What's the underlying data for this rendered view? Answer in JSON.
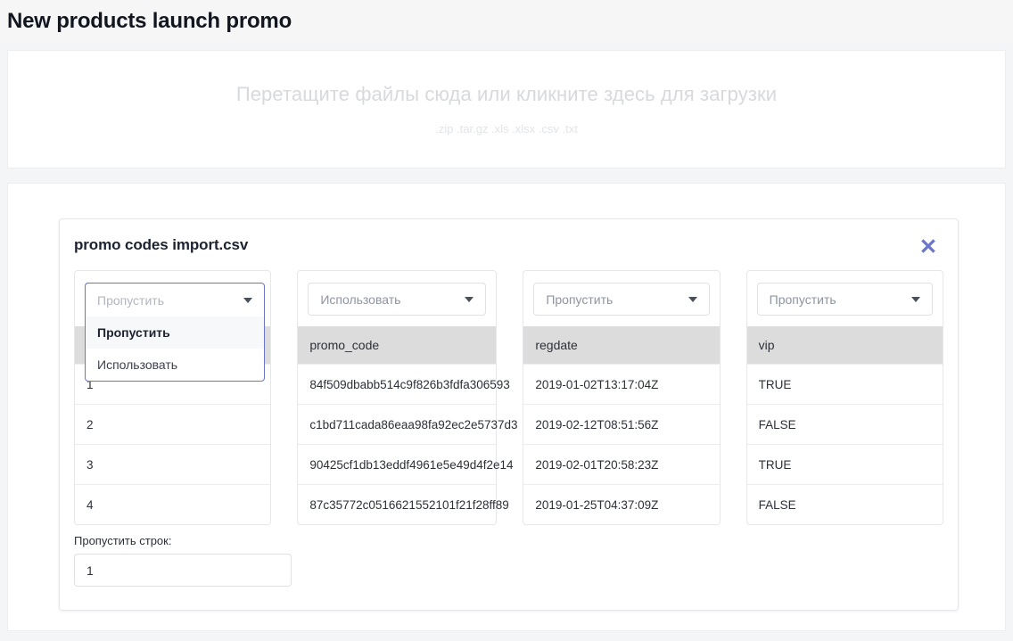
{
  "page": {
    "title": "New products launch promo"
  },
  "dropzone": {
    "main_text": "Перетащите файлы сюда или кликните здесь для загрузки",
    "formats_text": ".zip .tar.gz .xls .xlsx .csv .txt"
  },
  "file_card": {
    "file_name": "promo codes import.csv",
    "close_label": "✖",
    "accent_color": "#6b76c9",
    "header_bg": "#dcdcdc",
    "skip_rows": {
      "label": "Пропустить строк:",
      "value": "1",
      "placeholder": "0"
    },
    "select_options": [
      "Пропустить",
      "Использовать"
    ],
    "open_dropdown": {
      "column_index": 0,
      "current_value": "Пропустить",
      "options": [
        "Пропустить",
        "Использовать"
      ],
      "active_option": "Пропустить"
    },
    "columns": [
      {
        "select_value": "Пропустить",
        "header": "",
        "cells": [
          "1",
          "2",
          "3",
          "4"
        ]
      },
      {
        "select_value": "Использовать",
        "header": "promo_code",
        "cells": [
          "84f509dbabb514c9f826b3fdfa306593",
          "c1bd711cada86eaa98fa92ec2e5737d3",
          "90425cf1db13eddf4961e5e49d4f2e14",
          "87c35772c0516621552101f21f28ff89"
        ]
      },
      {
        "select_value": "Пропустить",
        "header": "regdate",
        "cells": [
          "2019-01-02T13:17:04Z",
          "2019-02-12T08:51:56Z",
          "2019-02-01T20:58:23Z",
          "2019-01-25T04:37:09Z"
        ]
      },
      {
        "select_value": "Пропустить",
        "header": "vip",
        "cells": [
          "TRUE",
          "FALSE",
          "TRUE",
          "FALSE"
        ]
      }
    ]
  }
}
